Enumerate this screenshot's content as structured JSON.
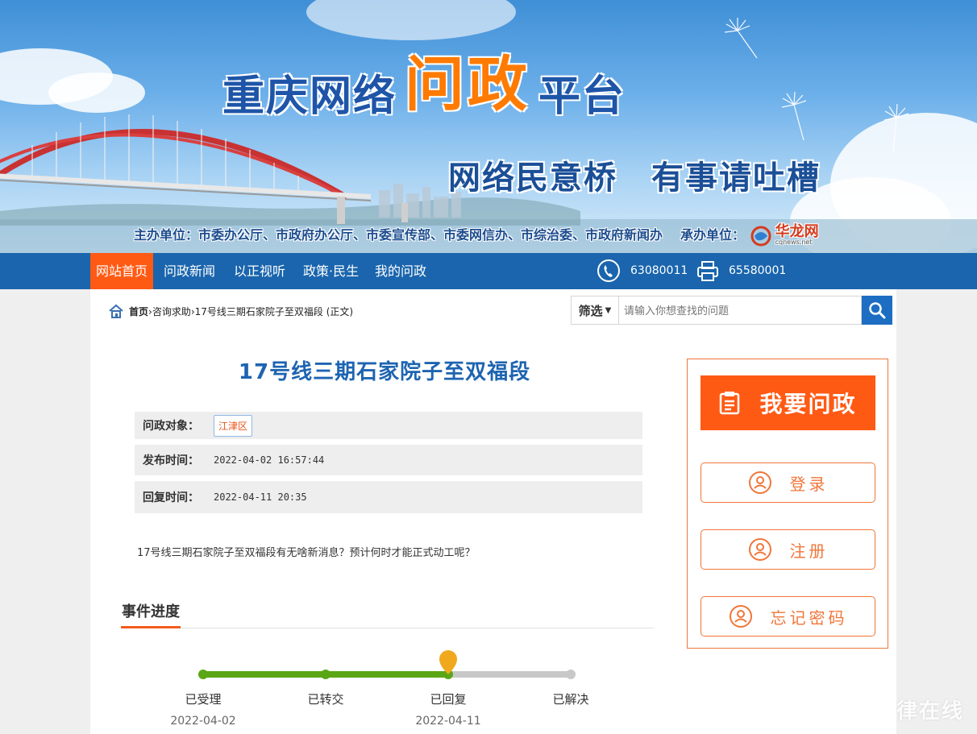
{
  "banner": {
    "title_part1": "重庆网络",
    "title_part2": "问政",
    "title_part3": "平台",
    "slogan": "网络民意桥　有事请吐槽",
    "sponsors_text": "主办单位：市委办公厅、市政府办公厅、市委宣传部、市委网信办、市综治委、市政府新闻办",
    "undertaker_label": "承办单位：",
    "undertaker_name": "华龙网",
    "undertaker_domain": "cqnews.net"
  },
  "nav": {
    "items": [
      "网站首页",
      "问政新闻",
      "以正视听",
      "政策·民生",
      "我的问政"
    ],
    "active_index": 0,
    "phone": "63080011",
    "fax": "65580001",
    "color": "#1a65ad",
    "active_color": "#ff5a14"
  },
  "breadcrumb": {
    "home": "首页",
    "path": "›咨询求助›17号线三期石家院子至双福段 (正文)"
  },
  "search": {
    "filter_label": "筛选",
    "placeholder": "请输入你想查找的问题"
  },
  "article": {
    "title": "17号线三期石家院子至双福段",
    "target_label": "问政对象：",
    "target_value": "江津区",
    "publish_label": "发布时间：",
    "publish_time": "2022-04-02 16:57:44",
    "reply_label": "回复时间：",
    "reply_time": "2022-04-11 20:35",
    "body": "17号线三期石家院子至双福段有无啥新消息？预计何时才能正式动工呢？"
  },
  "progress": {
    "section_title": "事件进度",
    "stages": [
      {
        "label": "已受理",
        "date": "2022-04-02"
      },
      {
        "label": "已转交",
        "date": ""
      },
      {
        "label": "已回复",
        "date": "2022-04-11"
      },
      {
        "label": "已解决",
        "date": ""
      }
    ],
    "current_stage_index": 2,
    "done_color": "#5aa614",
    "pending_color": "#c8c8c8",
    "marker_color": "#f0a91c"
  },
  "sidebar": {
    "ask_label": "我要问政",
    "login_label": "登录",
    "register_label": "注册",
    "forgot_label": "忘记密码",
    "accent_color": "#f0763a"
  },
  "watermark": "律在线"
}
